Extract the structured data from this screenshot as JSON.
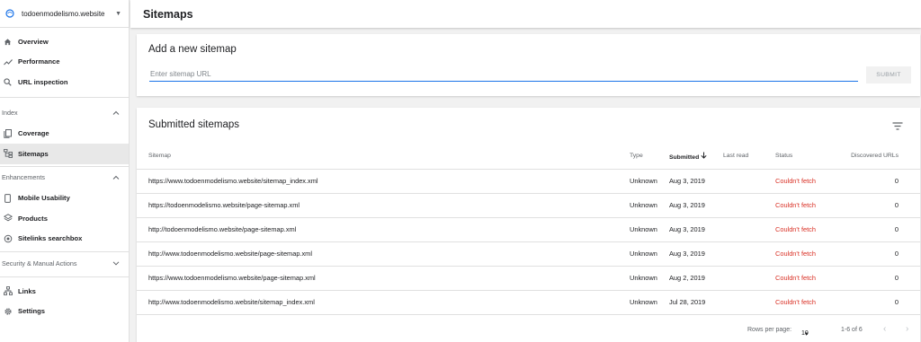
{
  "sidebar": {
    "property": "todoenmodelismo.website",
    "top_items": [
      {
        "label": "Overview",
        "icon": "home-icon"
      },
      {
        "label": "Performance",
        "icon": "trending-icon"
      },
      {
        "label": "URL inspection",
        "icon": "search-icon"
      }
    ],
    "index_section": "Index",
    "index_items": [
      {
        "label": "Coverage",
        "icon": "coverage-icon"
      },
      {
        "label": "Sitemaps",
        "icon": "sitemap-icon"
      }
    ],
    "enhancements_section": "Enhancements",
    "enhancement_items": [
      {
        "label": "Mobile Usability",
        "icon": "phone-icon"
      },
      {
        "label": "Products",
        "icon": "products-icon"
      },
      {
        "label": "Sitelinks searchbox",
        "icon": "searchbox-icon"
      }
    ],
    "security_section": "Security & Manual Actions",
    "bottom_items": [
      {
        "label": "Links",
        "icon": "links-icon"
      },
      {
        "label": "Settings",
        "icon": "gear-icon"
      }
    ]
  },
  "header": {
    "title": "Sitemaps"
  },
  "add": {
    "title": "Add a new sitemap",
    "placeholder": "Enter sitemap URL",
    "submit": "SUBMIT"
  },
  "submitted": {
    "title": "Submitted sitemaps",
    "columns": {
      "sitemap": "Sitemap",
      "type": "Type",
      "submitted": "Submitted",
      "last_read": "Last read",
      "status": "Status",
      "discovered": "Discovered URLs"
    },
    "rows": [
      {
        "sitemap": "https://www.todoenmodelismo.website/sitemap_index.xml",
        "type": "Unknown",
        "submitted": "Aug 3, 2019",
        "last_read": "",
        "status": "Couldn't fetch",
        "discovered": "0"
      },
      {
        "sitemap": "https://todoenmodelismo.website/page-sitemap.xml",
        "type": "Unknown",
        "submitted": "Aug 3, 2019",
        "last_read": "",
        "status": "Couldn't fetch",
        "discovered": "0"
      },
      {
        "sitemap": "http://todoenmodelismo.website/page-sitemap.xml",
        "type": "Unknown",
        "submitted": "Aug 3, 2019",
        "last_read": "",
        "status": "Couldn't fetch",
        "discovered": "0"
      },
      {
        "sitemap": "http://www.todoenmodelismo.website/page-sitemap.xml",
        "type": "Unknown",
        "submitted": "Aug 3, 2019",
        "last_read": "",
        "status": "Couldn't fetch",
        "discovered": "0"
      },
      {
        "sitemap": "https://www.todoenmodelismo.website/page-sitemap.xml",
        "type": "Unknown",
        "submitted": "Aug 2, 2019",
        "last_read": "",
        "status": "Couldn't fetch",
        "discovered": "0"
      },
      {
        "sitemap": "http://www.todoenmodelismo.website/sitemap_index.xml",
        "type": "Unknown",
        "submitted": "Jul 28, 2019",
        "last_read": "",
        "status": "Couldn't fetch",
        "discovered": "0"
      }
    ],
    "pager": {
      "rows_per_page_label": "Rows per page:",
      "rows_per_page": "10",
      "range": "1-6 of 6"
    }
  },
  "colors": {
    "accent": "#1a73e8",
    "error": "#d93025",
    "active_bg": "#e8e8e8"
  }
}
